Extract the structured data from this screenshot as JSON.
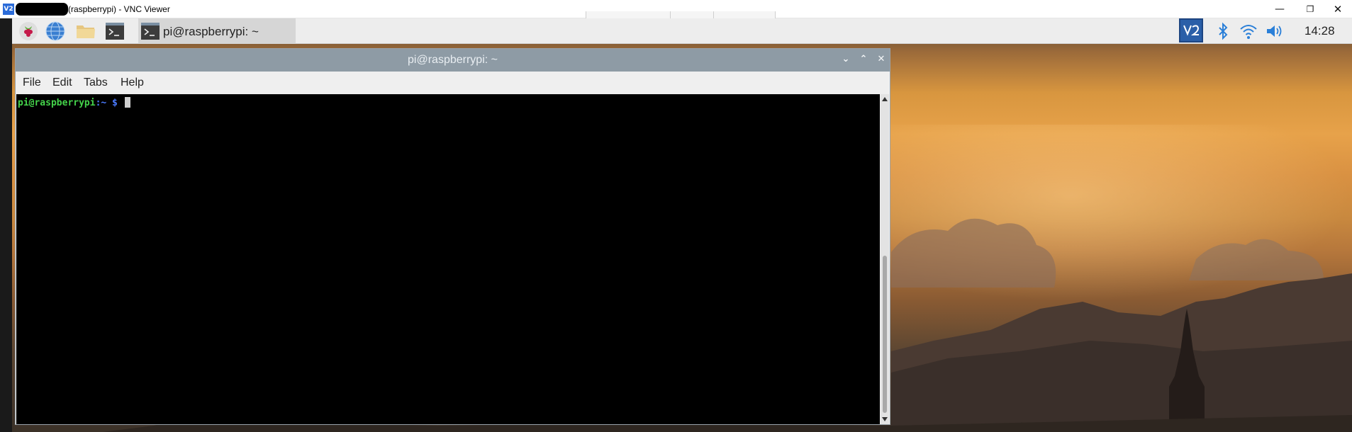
{
  "vnc_window": {
    "logo_text": "V2",
    "title": "(raspberrypi) - VNC Viewer",
    "controls": {
      "minimize": "—",
      "restore": "❐",
      "close": "✕"
    }
  },
  "taskbar": {
    "launchers": [
      "raspberry-menu-icon",
      "web-browser-icon",
      "file-manager-icon",
      "terminal-icon"
    ],
    "task_label": "pi@raspberrypi: ~",
    "tray": [
      "vnc-server-icon",
      "bluetooth-icon",
      "wifi-icon",
      "volume-icon"
    ],
    "clock": "14:28"
  },
  "terminal": {
    "title": "pi@raspberrypi: ~",
    "buttons": {
      "minimize": "⌄",
      "maximize": "⌃",
      "close": "✕"
    },
    "menu": [
      "File",
      "Edit",
      "Tabs",
      "Help"
    ],
    "prompt": {
      "user": "pi@raspberrypi",
      "sep": ":",
      "path": "~ $"
    }
  },
  "colors": {
    "terminal_bg": "#000000",
    "prompt_user": "#44d34a",
    "prompt_path": "#4a7bff",
    "titlebar": "#8e9ba5",
    "taskbar": "#ededed",
    "vnc_brand": "#2b6cd9"
  }
}
